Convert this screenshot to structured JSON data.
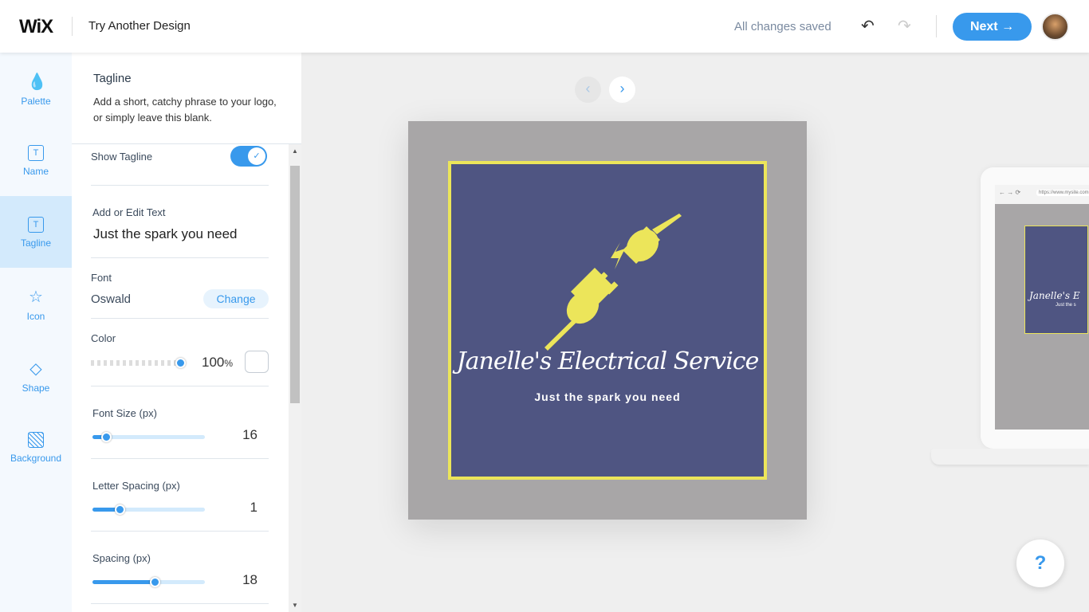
{
  "header": {
    "logo": "WiX",
    "title": "Try Another Design",
    "status": "All changes saved",
    "next_label": "Next →"
  },
  "rail": [
    {
      "label": "Palette",
      "icon": "drop-icon"
    },
    {
      "label": "Name",
      "icon": "text-box-icon"
    },
    {
      "label": "Tagline",
      "icon": "text-box-icon",
      "active": true
    },
    {
      "label": "Icon",
      "icon": "star-icon"
    },
    {
      "label": "Shape",
      "icon": "diamond-icon"
    },
    {
      "label": "Background",
      "icon": "hatch-icon"
    }
  ],
  "panel": {
    "title": "Tagline",
    "description": "Add a short, catchy phrase to your logo, or simply leave this blank.",
    "show_tagline": {
      "label": "Show Tagline",
      "on": true
    },
    "text": {
      "label": "Add or Edit Text",
      "value": "Just the spark you need"
    },
    "font": {
      "label": "Font",
      "value": "Oswald",
      "change": "Change"
    },
    "color": {
      "label": "Color",
      "opacity": "100",
      "unit": "%"
    },
    "font_size": {
      "label": "Font Size (px)",
      "value": "16",
      "fraction": 0.12
    },
    "letter_spacing": {
      "label": "Letter Spacing (px)",
      "value": "1",
      "fraction": 0.24
    },
    "spacing": {
      "label": "Spacing (px)",
      "value": "18",
      "fraction": 0.55
    }
  },
  "logo": {
    "name": "Janelle's Electrical Service",
    "tagline": "Just the spark you need",
    "bg": "#4f5582",
    "accent": "#ece55a",
    "outer": "#a8a6a7"
  },
  "preview": {
    "url": "https://www.mysite.com",
    "name_short": "Janelle's E",
    "tag_short": "Just the s"
  },
  "help": "?"
}
